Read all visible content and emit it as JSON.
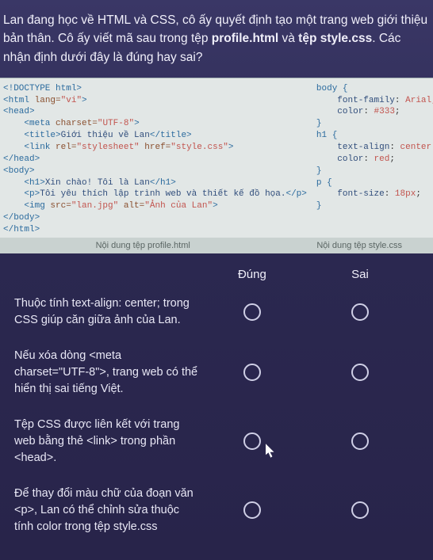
{
  "question_html": "Lan đang học về HTML và CSS, cô ấy quyết định tạo một trang web giới thiệu bản thân. Cô ấy viết mã sau trong tệp <b>profile.html</b> và <b>tệp style.css</b>. Các nhận định dưới đây là đúng hay sai?",
  "code": {
    "html_label": "Nội dung tệp profile.html",
    "css_label": "Nội dung tệp style.css",
    "html_lines": [
      {
        "t": "decl",
        "s": "<!DOCTYPE html>"
      },
      {
        "t": "open",
        "tag": "html",
        "attrs": [
          [
            "lang",
            "\"vi\""
          ]
        ]
      },
      {
        "t": "open",
        "tag": "head"
      },
      {
        "t": "void",
        "tag": "meta",
        "attrs": [
          [
            "charset",
            "\"UTF-8\""
          ]
        ],
        "indent": 4
      },
      {
        "t": "pair",
        "tag": "title",
        "text": "Giới thiệu về Lan",
        "indent": 4
      },
      {
        "t": "void",
        "tag": "link",
        "attrs": [
          [
            "rel",
            "\"stylesheet\""
          ],
          [
            "href",
            "\"style.css\""
          ]
        ],
        "indent": 4
      },
      {
        "t": "close",
        "tag": "head"
      },
      {
        "t": "open",
        "tag": "body"
      },
      {
        "t": "pair",
        "tag": "h1",
        "text": "Xin chào! Tôi là Lan",
        "indent": 4
      },
      {
        "t": "pair",
        "tag": "p",
        "text": "Tôi yêu thích lập trình web và thiết kế đồ họa.",
        "indent": 4
      },
      {
        "t": "void",
        "tag": "img",
        "attrs": [
          [
            "src",
            "\"lan.jpg\""
          ],
          [
            "alt",
            "\"Ảnh của Lan\""
          ]
        ],
        "indent": 4
      },
      {
        "t": "close",
        "tag": "body"
      },
      {
        "t": "close",
        "tag": "html"
      }
    ],
    "css_blocks": [
      {
        "sel": "body",
        "decls": [
          [
            "font-family",
            "Arial, sans-s"
          ],
          [
            "color",
            "#333"
          ]
        ]
      },
      {
        "sel": "h1",
        "decls": [
          [
            "text-align",
            "center"
          ],
          [
            "color",
            "red"
          ]
        ]
      },
      {
        "sel": "p",
        "decls": [
          [
            "font-size",
            "18px"
          ]
        ]
      }
    ]
  },
  "columns": {
    "true": "Đúng",
    "false": "Sai"
  },
  "statements": [
    "Thuộc tính text-align: center; trong CSS giúp căn giữa ảnh của Lan.",
    "Nếu xóa dòng <meta charset=\"UTF-8\">, trang web có thể hiển thị sai tiếng Việt.",
    "Tệp CSS được liên kết với trang web bằng thẻ <link> trong phần <head>.",
    "Để thay đổi màu chữ của đoạn văn <p>, Lan có thể chỉnh sửa thuộc tính color trong tệp style.css"
  ]
}
